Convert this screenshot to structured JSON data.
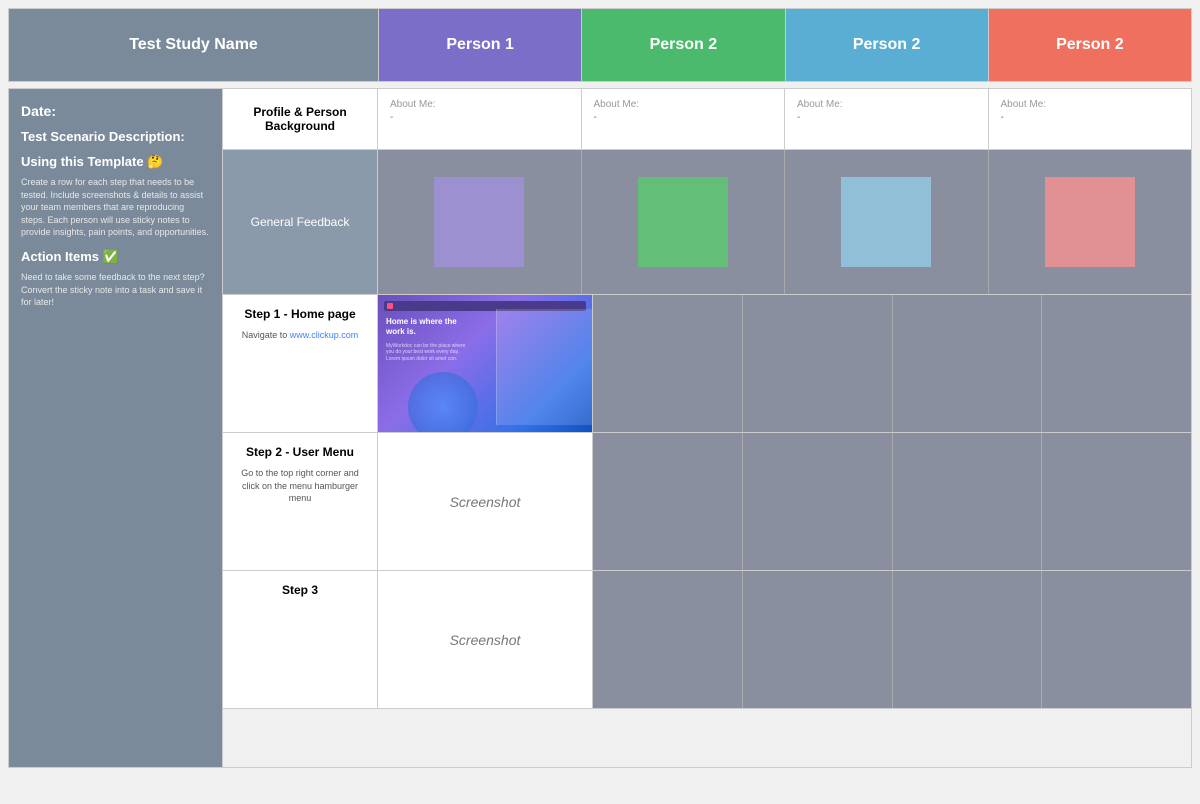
{
  "header": {
    "study_name": "Test Study Name",
    "persons": [
      {
        "label": "Person 1",
        "color_class": "person-purple"
      },
      {
        "label": "Person 2",
        "color_class": "person-green"
      },
      {
        "label": "Person 2",
        "color_class": "person-blue"
      },
      {
        "label": "Person 2",
        "color_class": "person-red"
      }
    ]
  },
  "sidebar": {
    "date_label": "Date:",
    "scenario_label": "Test Scenario Description:",
    "using_label": "Using this Template 🤔",
    "using_body": "Create a row for each step that needs to be tested. Include screenshots & details to assist your team members that are reproducing steps. Each person will use sticky notes to provide insights, pain points, and opportunities.",
    "action_label": "Action Items ✅",
    "action_body": "Need to take some feedback to the next step? Convert the sticky note into a task and save it for later!"
  },
  "profile_row": {
    "label_line1": "Profile & Person",
    "label_line2": "Background",
    "persons": [
      {
        "about_label": "About Me:",
        "about_value": "-"
      },
      {
        "about_label": "About Me:",
        "about_value": "-"
      },
      {
        "about_label": "About Me:",
        "about_value": "-"
      },
      {
        "about_label": "About Me:",
        "about_value": "-"
      }
    ]
  },
  "feedback_row": {
    "label": "General Feedback"
  },
  "steps": [
    {
      "title": "Step 1 - Home page",
      "description": "Navigate to www.clickup.com",
      "has_screenshot_image": true,
      "screenshot_text": ""
    },
    {
      "title": "Step 2 - User Menu",
      "description": "Go to the top right corner and click on the menu hamburger menu",
      "has_screenshot_image": false,
      "screenshot_text": "Screenshot"
    },
    {
      "title": "Step 3",
      "description": "",
      "has_screenshot_image": false,
      "screenshot_text": "Screenshot"
    }
  ]
}
